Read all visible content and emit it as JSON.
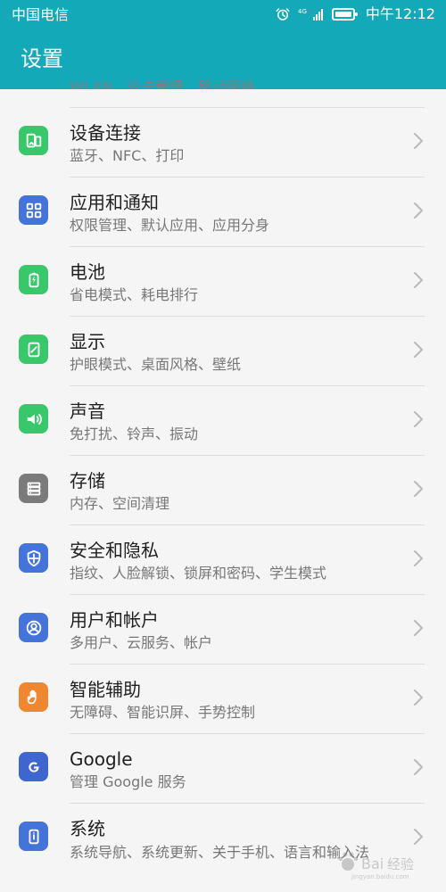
{
  "status_bar": {
    "carrier": "中国电信",
    "network": "4G",
    "time": "中午12:12"
  },
  "app": {
    "title": "设置",
    "partial_item_text": "WLAN、双卡管理、移动网络"
  },
  "colors": {
    "header": "#13a9b9",
    "green": "#38c76a",
    "blue": "#4473d9",
    "gray": "#7b7b7b",
    "orange": "#f0862f",
    "navy": "#3f66cf"
  },
  "settings_items": [
    {
      "title": "设备连接",
      "subtitle": "蓝牙、NFC、打印",
      "icon": "device-connection-icon"
    },
    {
      "title": "应用和通知",
      "subtitle": "权限管理、默认应用、应用分身",
      "icon": "apps-notifications-icon"
    },
    {
      "title": "电池",
      "subtitle": "省电模式、耗电排行",
      "icon": "battery-icon"
    },
    {
      "title": "显示",
      "subtitle": "护眼模式、桌面风格、壁纸",
      "icon": "display-icon"
    },
    {
      "title": "声音",
      "subtitle": "免打扰、铃声、振动",
      "icon": "sound-icon"
    },
    {
      "title": "存储",
      "subtitle": "内存、空间清理",
      "icon": "storage-icon"
    },
    {
      "title": "安全和隐私",
      "subtitle": "指纹、人脸解锁、锁屏和密码、学生模式",
      "icon": "security-icon"
    },
    {
      "title": "用户和帐户",
      "subtitle": "多用户、云服务、帐户",
      "icon": "users-accounts-icon"
    },
    {
      "title": "智能辅助",
      "subtitle": "无障碍、智能识屏、手势控制",
      "icon": "smart-assist-icon"
    },
    {
      "title": "Google",
      "subtitle": "管理 Google 服务",
      "icon": "google-icon"
    },
    {
      "title": "系统",
      "subtitle": "系统导航、系统更新、关于手机、语言和输入法",
      "icon": "system-icon"
    }
  ]
}
